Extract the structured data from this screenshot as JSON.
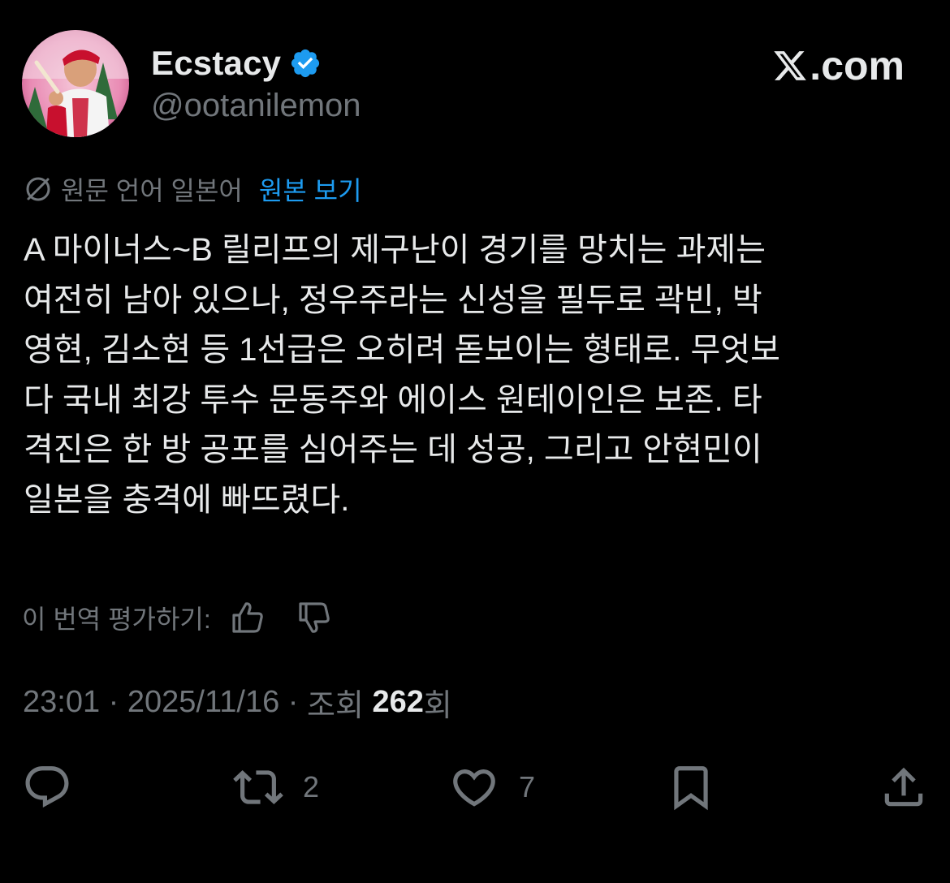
{
  "author": {
    "display_name": "Ecstacy",
    "handle": "@ootanilemon",
    "verified": true,
    "avatar": "avatar-image"
  },
  "brand": {
    "label": ".com",
    "icon": "x-logo-icon"
  },
  "translation": {
    "icon": "translate-icon",
    "language_note": "원문 언어 일본어",
    "show_original": "원본 보기"
  },
  "tweet": {
    "lines": [
      "A 마이너스~B 릴리프의 제구난이 경기를 망치는 과제는",
      "여전히 남아 있으나, 정우주라는 신성을 필두로 곽빈, 박",
      "영현, 김소현 등 1선급은 오히려 돋보이는 형태로. 무엇보",
      "다 국내 최강 투수 문동주와 에이스 원테이인은 보존. 타",
      "격진은 한 방 공포를 심어주는 데 성공, 그리고 안현민이",
      "일본을 충격에 빠뜨렸다."
    ]
  },
  "rating": {
    "label": "이 번역 평가하기:",
    "up_icon": "thumbs-up-icon",
    "down_icon": "thumbs-down-icon"
  },
  "meta": {
    "time": "23:01",
    "separator": " · ",
    "date": "2025/11/16",
    "views_prefix": "조회 ",
    "views_count": "262",
    "views_suffix": "회"
  },
  "actions": {
    "reply": {
      "icon": "reply-icon",
      "count": ""
    },
    "repost": {
      "icon": "repost-icon",
      "count": "2"
    },
    "like": {
      "icon": "heart-icon",
      "count": "7"
    },
    "bookmark": {
      "icon": "bookmark-icon",
      "count": ""
    },
    "share": {
      "icon": "share-icon",
      "count": ""
    }
  },
  "colors": {
    "background": "#000000",
    "text": "#e7e9ea",
    "secondary": "#71767b",
    "link": "#1d9bf0",
    "verified": "#1d9bf0"
  }
}
